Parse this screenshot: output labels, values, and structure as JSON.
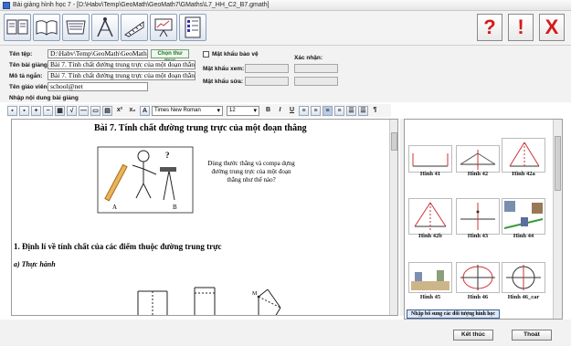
{
  "window": {
    "title": "Bài giảng hình học 7 - [D:\\Habv\\Temp\\GeoMath\\GeoMath7\\GMaths\\L7_HH_C2_B7.gmath]"
  },
  "toolbar": {
    "left_tools": [
      "book-icon",
      "open-book-icon",
      "notebook-icon",
      "compass-icon",
      "ruler-icon",
      "presentation-icon",
      "checklist-icon"
    ],
    "right_buttons": [
      {
        "icon": "help-icon",
        "glyph": "?"
      },
      {
        "icon": "alert-icon",
        "glyph": "!"
      },
      {
        "icon": "close-icon",
        "glyph": "X"
      }
    ]
  },
  "form": {
    "file_label": "Tên tệp:",
    "file_value": "D:\\Habv\\Temp\\GeoMath\\GeoMath7",
    "choose_folder": "Chọn thư mục",
    "title_label": "Tên bài giảng:",
    "title_value": "Bài 7. Tính chất đường trung trực của một đoạn thẳng",
    "summary_label": "Mô tả ngắn:",
    "summary_value": "Bài 7. Tính chất đường trung trực của một đoạn thẳng",
    "teacher_label": "Tên giáo viên:",
    "teacher_value": "school@net",
    "protect_label": "Mật khẩu bảo vệ",
    "confirm_label": "Xác nhận:",
    "view_pw_label": "Mật khẩu xem:",
    "edit_pw_label": "Mật khẩu sửa:",
    "content_label": "Nhập nội dung bài giảng"
  },
  "format_bar": {
    "font": "Times New Roman",
    "size": "12",
    "sup": "x²",
    "sub": "x₂",
    "bold": "B",
    "italic": "I",
    "underline": "U",
    "pilcrow": "¶"
  },
  "document": {
    "heading": "Bài 7. Tính chất đường trung trực của một đoạn thẳng",
    "question": "Dùng thước thẳng và compa dựng đường trung trực của một đoạn thẳng như thế nào?",
    "point_a": "A",
    "point_b": "B",
    "question_mark": "?",
    "section1": "1. Định lí về tính chất của các điểm thuộc đường trung trực",
    "subsection": "a) Thực hành",
    "point_m": "M"
  },
  "gallery": {
    "items": [
      "Hình 41",
      "Hình 42",
      "Hình 42a",
      "Hình 42b",
      "Hình 43",
      "Hình 44",
      "Hình 45",
      "Hình 46",
      "Hình 46_car"
    ],
    "add_button": "Nhập bổ sung các đối tượng hình học"
  },
  "footer": {
    "end_button": "Kết thúc",
    "exit_button": "Thoát"
  }
}
